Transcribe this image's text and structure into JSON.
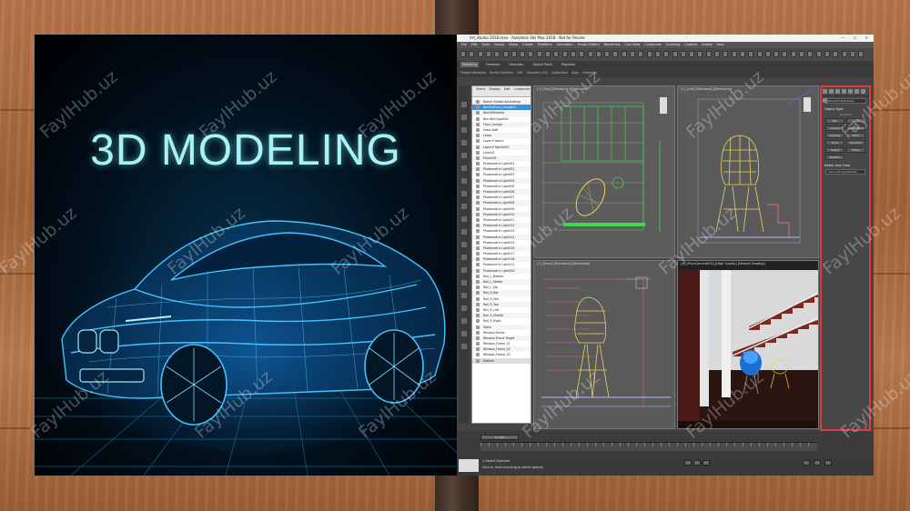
{
  "poster": {
    "title": "3D MODELING"
  },
  "app": {
    "window_title": "Art_Studio 2018.max - Autodesk 3ds Max 2018 - Not for Resale",
    "window_controls": "— ☐ ✕",
    "menu": [
      "File",
      "Edit",
      "Tools",
      "Group",
      "Views",
      "Create",
      "Modifiers",
      "Animation",
      "Graph Editors",
      "Rendering",
      "Civil View",
      "Customize",
      "Scripting",
      "Content",
      "Arnold",
      "Help"
    ],
    "ribbon_tabs": [
      "Modeling",
      "Freeform",
      "Selection",
      "Object Paint",
      "Populate"
    ],
    "ribbon_sub": [
      "Polygon Modeling",
      "Modify Selection",
      "Edit",
      "Geometry (All)",
      "Subdivision",
      "Align",
      "Properties"
    ],
    "scene_explorer": {
      "tabs": [
        "Select",
        "Display",
        "Edit",
        "Customize"
      ],
      "rows": [
        "Name (Sorted Ascending)",
        "Box004Front_Glass001",
        "Box006Interior",
        "Box Wall Spot001",
        "Floor_Lounge",
        "Glass Wall",
        "Lamp",
        "Layer:0 Name",
        "Layer:0 Name001",
        "Line001",
        "Plane001",
        "Photometric Light001",
        "Photometric Light002",
        "Photometric Light003",
        "Photometric Light004",
        "Photometric Light005",
        "Photometric Light006",
        "Photometric Light007",
        "Photometric Light008",
        "Photometric Light009",
        "Photometric Light010",
        "Photometric Light011",
        "Photometric Light012",
        "Photometric Light013",
        "Photometric Light014",
        "Photometric Light015",
        "Photometric Light016",
        "Photometric Light017",
        "Photometric Light018",
        "Photometric Light019",
        "Photometric Light020",
        "Rail_L_Bottom",
        "Rail_L_Middle",
        "Rail_L_Top",
        "Rail_R_Bot",
        "Rail_R_Mid",
        "Rail_R_Top",
        "Rail_R_Left",
        "Rail_R_Middle",
        "Rail_R_Right",
        "Stairs",
        "Window Frame",
        "Window Frame Target",
        "Window_Frame_01",
        "Window_Frame_02",
        "Window_Frame_03"
      ],
      "selected_index": 1,
      "footer": "Default"
    },
    "viewports": [
      {
        "label": "[+] [Top] [Standard] [Wireframe]"
      },
      {
        "label": "[+] [Left] [Standard] [Wireframe]"
      },
      {
        "label": "[+] [Front] [Standard] [Wireframe]"
      },
      {
        "label": "[+] [PhysCamera001] [High Quality] [Default Shading]"
      }
    ],
    "command_panel": {
      "dropdown": "Standard Primitives",
      "object_type_header": "Object Type",
      "autogrid": "AutoGrid",
      "buttons": [
        "Box",
        "Cone",
        "Sphere",
        "GeoSphere",
        "Cylinder",
        "Tube",
        "Torus",
        "Pyramid",
        "Teapot",
        "Plane",
        "TextPlus"
      ],
      "name_color_header": "Name and Color",
      "name_value": "Line Loft Cylinder001"
    },
    "timeline": {
      "slider": "0 / 100"
    },
    "status": {
      "line1": "1 Object Selected",
      "line2": "Click or click-and-drag to select objects"
    }
  },
  "watermark": "FaylHub.uz",
  "colors": {
    "accent_red": "#e03a3a",
    "selection_blue": "#3c8fd8",
    "wire_yellow": "#e8d35a",
    "wire_green": "#3cd94a",
    "poster_glow": "#39b6ff"
  }
}
